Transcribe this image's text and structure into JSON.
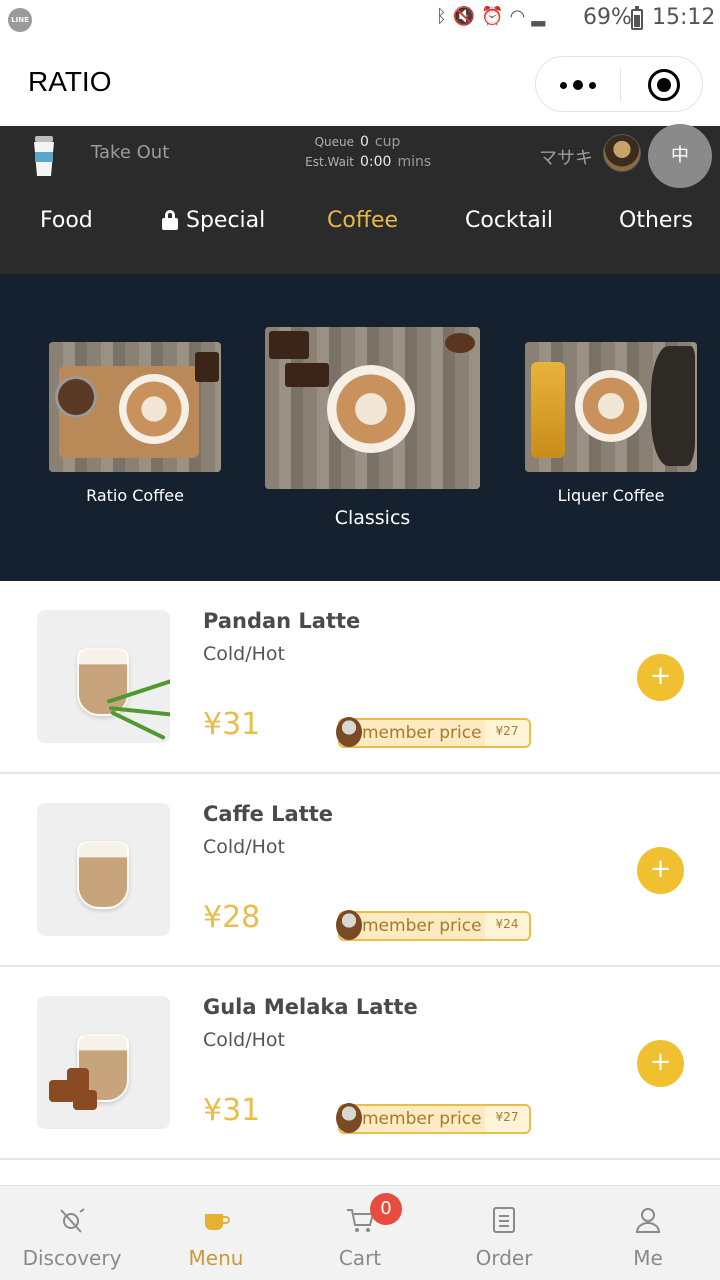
{
  "status_bar": {
    "app_icon_text": "LINE",
    "battery": "69%",
    "time": "15:12"
  },
  "header": {
    "title": "RATIO"
  },
  "info_bar": {
    "take_out": "Take Out",
    "queue_label": "Queue",
    "queue_value": "0",
    "queue_unit": "cup",
    "wait_label": "Est.Wait",
    "wait_value": "0:00",
    "wait_unit": "mins",
    "user_name": "マサキ",
    "language_button": "中"
  },
  "tabs": [
    {
      "label": "Food",
      "active": false
    },
    {
      "label": "Special",
      "active": false,
      "locked": true
    },
    {
      "label": "Coffee",
      "active": true
    },
    {
      "label": "Cocktail",
      "active": false
    },
    {
      "label": "Others",
      "active": false
    }
  ],
  "categories": [
    {
      "label": "Ratio Coffee"
    },
    {
      "label": "Classics",
      "selected": true
    },
    {
      "label": "Liquer Coffee"
    }
  ],
  "items": [
    {
      "name": "Pandan Latte",
      "sub": "Cold/Hot",
      "price": "¥31",
      "member_label": "member price",
      "member_price": "¥27"
    },
    {
      "name": "Caffe Latte",
      "sub": "Cold/Hot",
      "price": "¥28",
      "member_label": "member price",
      "member_price": "¥24"
    },
    {
      "name": "Gula Melaka Latte",
      "sub": "Cold/Hot",
      "price": "¥31",
      "member_label": "member price",
      "member_price": "¥27"
    }
  ],
  "add_symbol": "+",
  "bottom_tabs": [
    {
      "label": "Discovery",
      "icon": "discovery-icon",
      "active": false
    },
    {
      "label": "Menu",
      "icon": "coffee-cup-icon",
      "active": true
    },
    {
      "label": "Cart",
      "icon": "cart-icon",
      "active": false,
      "badge": "0"
    },
    {
      "label": "Order",
      "icon": "order-list-icon",
      "active": false
    },
    {
      "label": "Me",
      "icon": "user-icon",
      "active": false
    }
  ],
  "colors": {
    "accent": "#e8b84a",
    "dark_bar": "#2b2b2b",
    "carousel_bg": "#162130",
    "badge": "#e84c3d",
    "add_button": "#f0c030"
  }
}
